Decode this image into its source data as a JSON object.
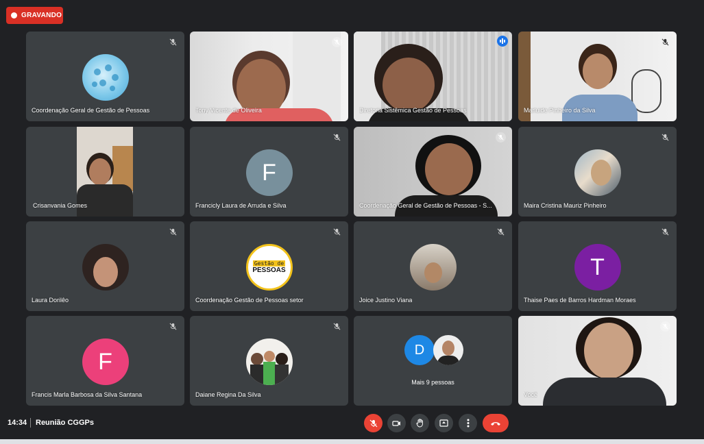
{
  "recording": {
    "label": "GRAVANDO"
  },
  "tiles": [
    {
      "name": "Coordenação Geral de Gestão de Pessoas"
    },
    {
      "name": "Tony Vicente de Oliveira"
    },
    {
      "name": "Diretoria Sistêmica Gestão de Pessoas"
    },
    {
      "name": "Marluide Pinheiro da Silva"
    },
    {
      "name": "Crisanvania Gomes"
    },
    {
      "name": "Francicly Laura de Arruda e Silva",
      "initial": "F"
    },
    {
      "name": "Coordenação Geral de Gestão de Pessoas - S..."
    },
    {
      "name": "Maira Cristina Mauriz Pinheiro"
    },
    {
      "name": "Laura Dorilêo"
    },
    {
      "name": "Coordenação Gestão de Pessoas setor",
      "logo_top": "Gestão de",
      "logo_bottom": "PESSOAS"
    },
    {
      "name": "Joice Justino Viana"
    },
    {
      "name": "Thaise Paes de Barros Hardman Moraes",
      "initial": "T"
    },
    {
      "name": "Francis Marla Barbosa da Silva Santana",
      "initial": "F"
    },
    {
      "name": "Daiane Regina Da Silva"
    },
    {
      "name": "Mais 9 pessoas",
      "initial": "D"
    },
    {
      "name": "Você"
    }
  ],
  "bottom": {
    "time": "14:34",
    "meeting": "Reunião CGGPs"
  },
  "colors": {
    "red": "#d93025",
    "tile": "#3c4043",
    "bg": "#202124",
    "active": "#1a73e8"
  }
}
